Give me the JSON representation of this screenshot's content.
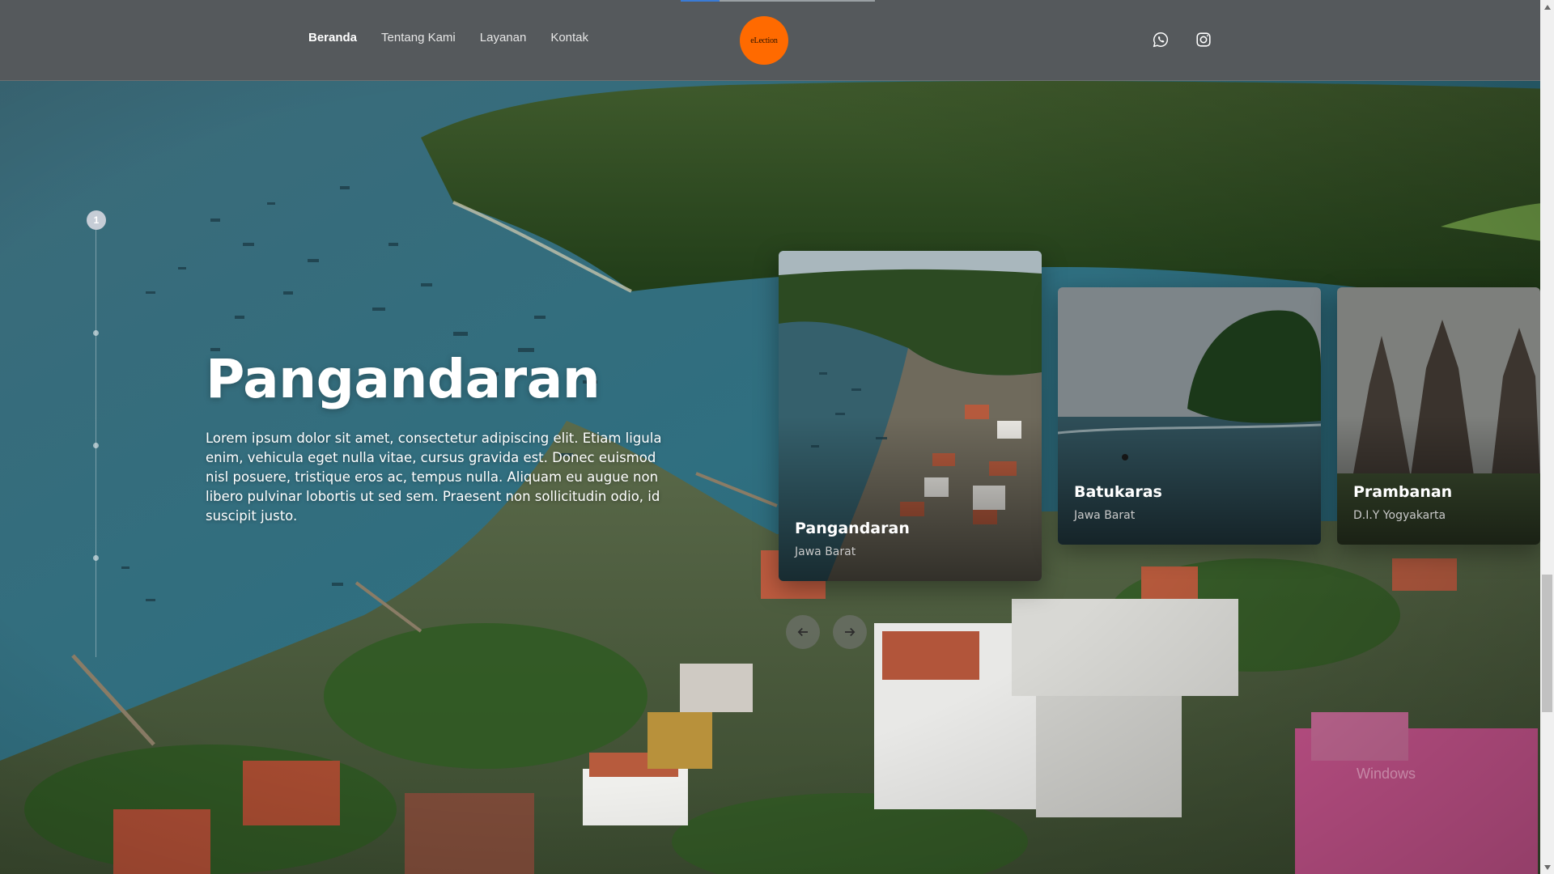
{
  "nav": {
    "items": [
      {
        "label": "Beranda",
        "active": true
      },
      {
        "label": "Tentang Kami"
      },
      {
        "label": "Layanan"
      },
      {
        "label": "Kontak"
      }
    ]
  },
  "logo": {
    "text": "eLection",
    "color": "#ff6a00"
  },
  "social": [
    {
      "icon": "whatsapp-icon"
    },
    {
      "icon": "instagram-icon"
    }
  ],
  "pager": {
    "current": "1",
    "total_dots": 4
  },
  "hero": {
    "title": "Pangandaran",
    "description": "Lorem ipsum dolor sit amet, consectetur adipiscing elit. Etiam ligula enim, vehicula eget nulla vitae, cursus gravida est. Donec euismod nisl posuere, tristique eros ac, tempus nulla. Aliquam eu augue non libero pulvinar lobortis ut sed sem. Praesent non sollicitudin odio, id suscipit justo."
  },
  "cards": [
    {
      "title": "Pangandaran",
      "subtitle": "Jawa Barat",
      "active": true
    },
    {
      "title": "Batukaras",
      "subtitle": "Jawa Barat"
    },
    {
      "title": "Prambanan",
      "subtitle": "D.I.Y Yogyakarta"
    }
  ],
  "controls": {
    "prev_icon": "arrow-left-icon",
    "next_icon": "arrow-right-icon"
  },
  "watermark": "Windows",
  "colors": {
    "accent": "#ff6a00",
    "topbar": "#55595c",
    "progress": "#3a7bd5"
  }
}
